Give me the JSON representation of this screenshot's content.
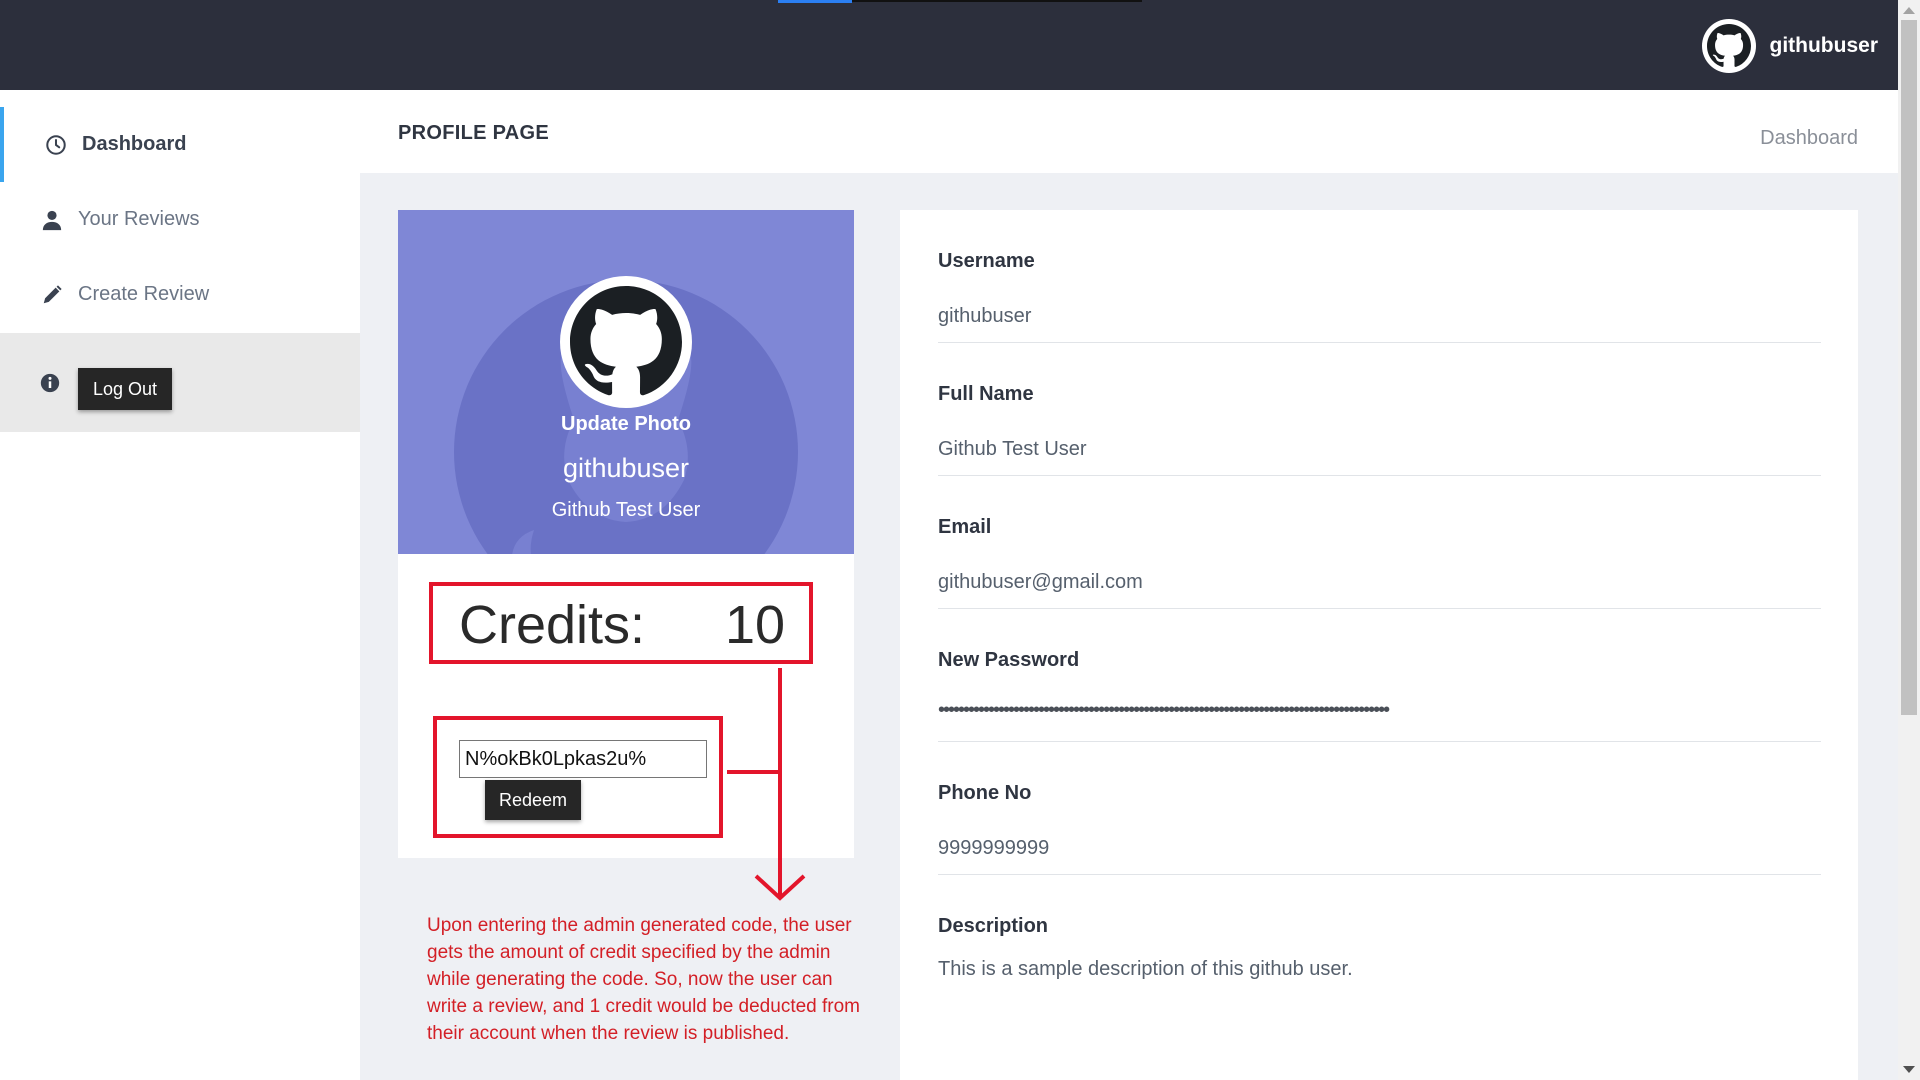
{
  "header": {
    "username": "githubuser",
    "avatar_icon": "github-icon"
  },
  "sidebar": {
    "items": [
      {
        "label": "Dashboard",
        "icon": "clock-icon",
        "active": true
      },
      {
        "label": "Your Reviews",
        "icon": "user-icon",
        "active": false
      },
      {
        "label": "Create Review",
        "icon": "pencil-icon",
        "active": false
      }
    ],
    "logout": {
      "label": "Log Out",
      "icon": "info-icon"
    }
  },
  "page": {
    "title": "PROFILE PAGE",
    "breadcrumb": "Dashboard"
  },
  "profile": {
    "update_photo_label": "Update Photo",
    "username": "githubuser",
    "full_name": "Github Test User",
    "credits_label": "Credits:",
    "credits_value": "10",
    "redeem_code": "N%okBk0Lpkas2u%",
    "redeem_label": "Redeem"
  },
  "annotation": {
    "text": "Upon entering the admin generated code, the user gets the amount of credit specified by the admin while generating the code. So, now the user can write a review, and 1 credit would be deducted from their account when the review is published.",
    "color": "#d31f26"
  },
  "details": {
    "fields": [
      {
        "label": "Username",
        "value": "githubuser"
      },
      {
        "label": "Full Name",
        "value": "Github Test User"
      },
      {
        "label": "Email",
        "value": "githubuser@gmail.com"
      },
      {
        "label": "New Password",
        "value": "••••••••••••••••••••••••••••••••••••••••••••••••••••••••••••••••••••••••••••••••••••••••••"
      },
      {
        "label": "Phone No",
        "value": "9999999999"
      },
      {
        "label": "Description",
        "value": "This is a sample description of this github user."
      }
    ]
  },
  "colors": {
    "topbar": "#2c2f3c",
    "accent": "#3aa5ee",
    "hero": "#7f87d6",
    "highlight": "#e3152b"
  }
}
